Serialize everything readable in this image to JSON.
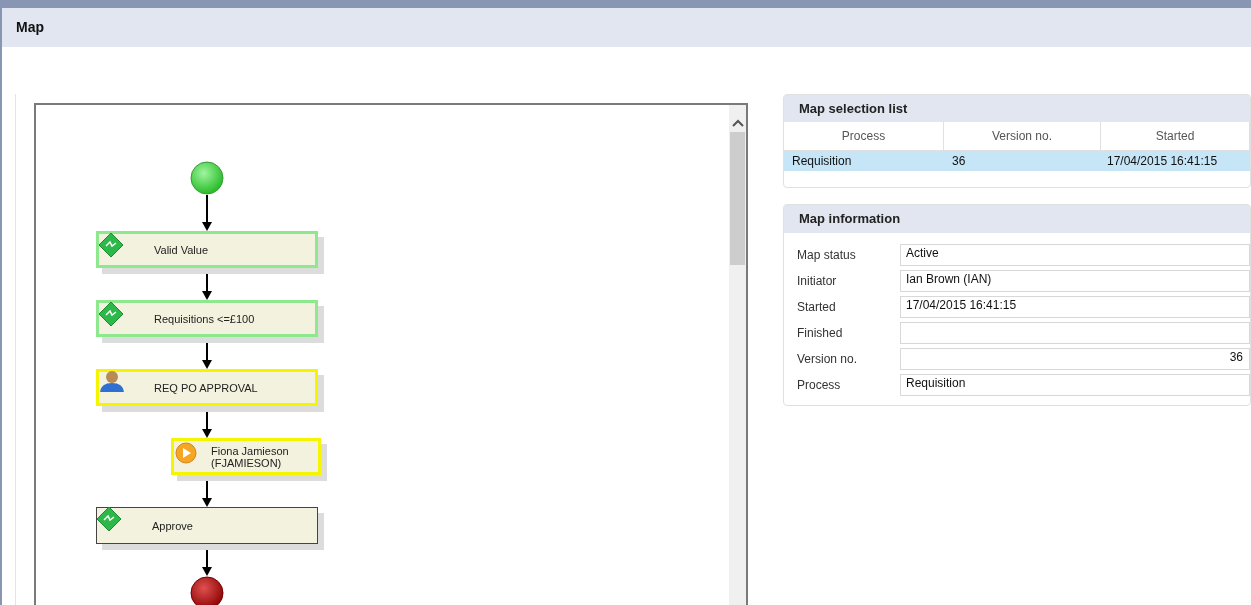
{
  "window": {
    "title": "Map"
  },
  "map": {
    "nodes": [
      {
        "kind": "start"
      },
      {
        "kind": "rule",
        "color": "#8ee88e",
        "label": "Valid Value"
      },
      {
        "kind": "rule",
        "color": "#8ee88e",
        "label": "Requisitions <=£100"
      },
      {
        "kind": "user",
        "color": "#f5f500",
        "label": "REQ PO APPROVAL"
      },
      {
        "kind": "assignee",
        "color": "#f5f500",
        "label": "Fiona Jamieson\n(FJAMIESON)"
      },
      {
        "kind": "rule",
        "color": "#444444",
        "label": "Approve"
      },
      {
        "kind": "end"
      }
    ]
  },
  "selection_list": {
    "title": "Map selection list",
    "columns": [
      "Process",
      "Version no.",
      "Started"
    ],
    "rows": [
      {
        "selected": true,
        "cells": [
          "Requisition",
          "36",
          "17/04/2015 16:41:15"
        ]
      }
    ]
  },
  "information": {
    "title": "Map information",
    "fields": [
      {
        "kind": "text",
        "label": "Map status",
        "value": "Active"
      },
      {
        "kind": "text",
        "label": "Initiator",
        "value": "Ian Brown (IAN)"
      },
      {
        "kind": "text",
        "label": "Started",
        "value": "17/04/2015 16:41:15"
      },
      {
        "kind": "text",
        "label": "Finished"
      },
      {
        "kind": "number",
        "label": "Version no.",
        "value": "36"
      },
      {
        "kind": "text",
        "label": "Process",
        "value": "Requisition"
      }
    ]
  }
}
